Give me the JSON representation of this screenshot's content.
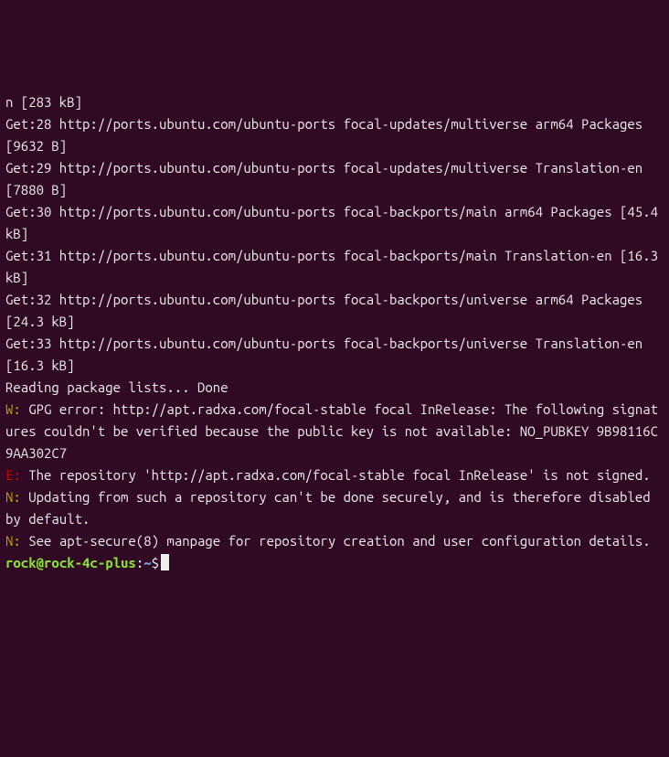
{
  "lines": [
    {
      "type": "plain",
      "text": "n [283 kB]"
    },
    {
      "type": "plain",
      "text": "Get:28 http://ports.ubuntu.com/ubuntu-ports focal-updates/multiverse arm64 Packages [9632 B]"
    },
    {
      "type": "plain",
      "text": "Get:29 http://ports.ubuntu.com/ubuntu-ports focal-updates/multiverse Translation-en [7880 B]"
    },
    {
      "type": "plain",
      "text": "Get:30 http://ports.ubuntu.com/ubuntu-ports focal-backports/main arm64 Packages [45.4 kB]"
    },
    {
      "type": "plain",
      "text": "Get:31 http://ports.ubuntu.com/ubuntu-ports focal-backports/main Translation-en [16.3 kB]"
    },
    {
      "type": "plain",
      "text": "Get:32 http://ports.ubuntu.com/ubuntu-ports focal-backports/universe arm64 Packages [24.3 kB]"
    },
    {
      "type": "plain",
      "text": "Get:33 http://ports.ubuntu.com/ubuntu-ports focal-backports/universe Translation-en [16.3 kB]"
    },
    {
      "type": "plain",
      "text": "Reading package lists... Done"
    },
    {
      "type": "warn",
      "prefix": "W:",
      "text": " GPG error: http://apt.radxa.com/focal-stable focal InRelease: The following signatures couldn't be verified because the public key is not available: NO_PUBKEY 9B98116C9AA302C7"
    },
    {
      "type": "err",
      "prefix": "E:",
      "text": " The repository 'http://apt.radxa.com/focal-stable focal InRelease' is not signed."
    },
    {
      "type": "notice",
      "prefix": "N:",
      "text": " Updating from such a repository can't be done securely, and is therefore disabled by default."
    },
    {
      "type": "notice",
      "prefix": "N:",
      "text": " See apt-secure(8) manpage for repository creation and user configuration details."
    }
  ],
  "prompt": {
    "user": "rock",
    "at": "@",
    "host": "rock-4c-plus",
    "colon": ":",
    "path": "~",
    "symbol": "$"
  }
}
